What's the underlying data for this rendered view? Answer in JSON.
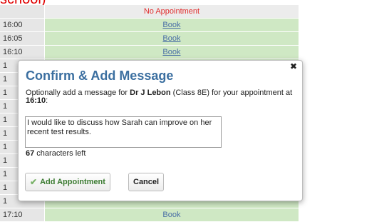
{
  "page": {
    "heading": "school)",
    "schedule": {
      "header": {
        "time": "",
        "status": "No Appointment"
      },
      "rows": [
        {
          "time": "16:00",
          "action": "Book"
        },
        {
          "time": "16:05",
          "action": "Book"
        },
        {
          "time": "16:10",
          "action": "Book"
        },
        {
          "time": "1",
          "action": ""
        },
        {
          "time": "1",
          "action": ""
        },
        {
          "time": "1",
          "action": ""
        },
        {
          "time": "1",
          "action": ""
        },
        {
          "time": "1",
          "action": ""
        },
        {
          "time": "1",
          "action": ""
        },
        {
          "time": "1",
          "action": ""
        },
        {
          "time": "1",
          "action": ""
        },
        {
          "time": "1",
          "action": ""
        },
        {
          "time": "1",
          "action": ""
        },
        {
          "time": "1",
          "action": ""
        },
        {
          "time": "17:10",
          "action": "Book"
        }
      ]
    }
  },
  "modal": {
    "title": "Confirm & Add Message",
    "close_icon": "close-icon",
    "text_prefix": "Optionally add a message for ",
    "teacher": "Dr J Lebon",
    "class_info": " (Class 8E) for your appointment at ",
    "time": "16:10",
    "text_suffix": ":",
    "message_value": "I would like to discuss how Sarah can improve on her recent test results.",
    "chars_count": "67",
    "chars_label": " characters left",
    "add_label": "Add Appointment",
    "cancel_label": "Cancel",
    "add_icon": "check-icon"
  }
}
